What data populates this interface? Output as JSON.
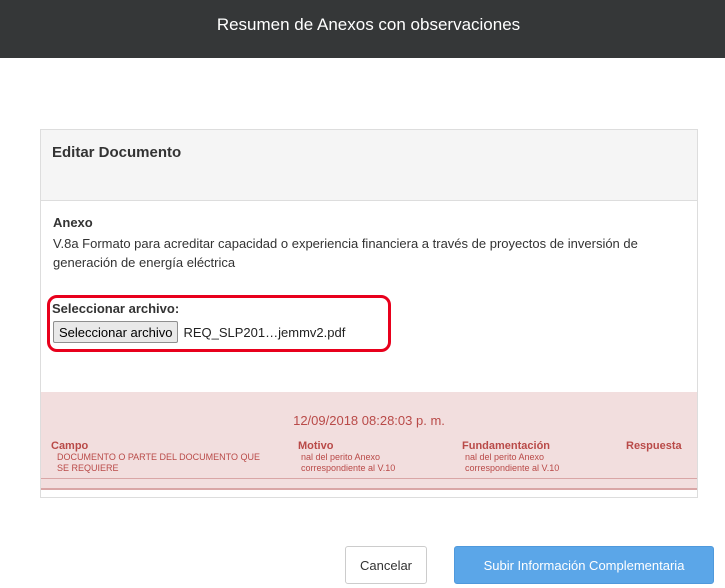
{
  "header": {
    "title": "Resumen de Anexos con observaciones"
  },
  "panel": {
    "title": "Editar Documento",
    "anexo_label": "Anexo",
    "anexo_text": "V.8a Formato para acreditar capacidad o experiencia financiera a través de proyectos de inversión de generación de energía eléctrica",
    "file": {
      "label": "Seleccionar archivo:",
      "button": "Seleccionar archivo",
      "filename": "REQ_SLP201…jemmv2.pdf"
    },
    "observations": {
      "date": "12/09/2018 08:28:03 p. m.",
      "columns": [
        "Campo",
        "Motivo",
        "Fundamentación",
        "Respuesta"
      ],
      "row": {
        "campo_1": "DOCUMENTO O PARTE DEL DOCUMENTO QUE",
        "campo_2": "SE REQUIERE",
        "motivo_1": "nal del perito Anexo",
        "motivo_2": "correspondiente al V.10",
        "fund_1": "nal del perito Anexo",
        "fund_2": "correspondiente al V.10"
      }
    }
  },
  "actions": {
    "cancel": "Cancelar",
    "submit": "Subir Información Complementaria"
  },
  "colors": {
    "accent": "#5ba6e8",
    "highlight": "#e8001c",
    "danger_bg": "#f2dede",
    "danger_text": "#b94a48"
  }
}
